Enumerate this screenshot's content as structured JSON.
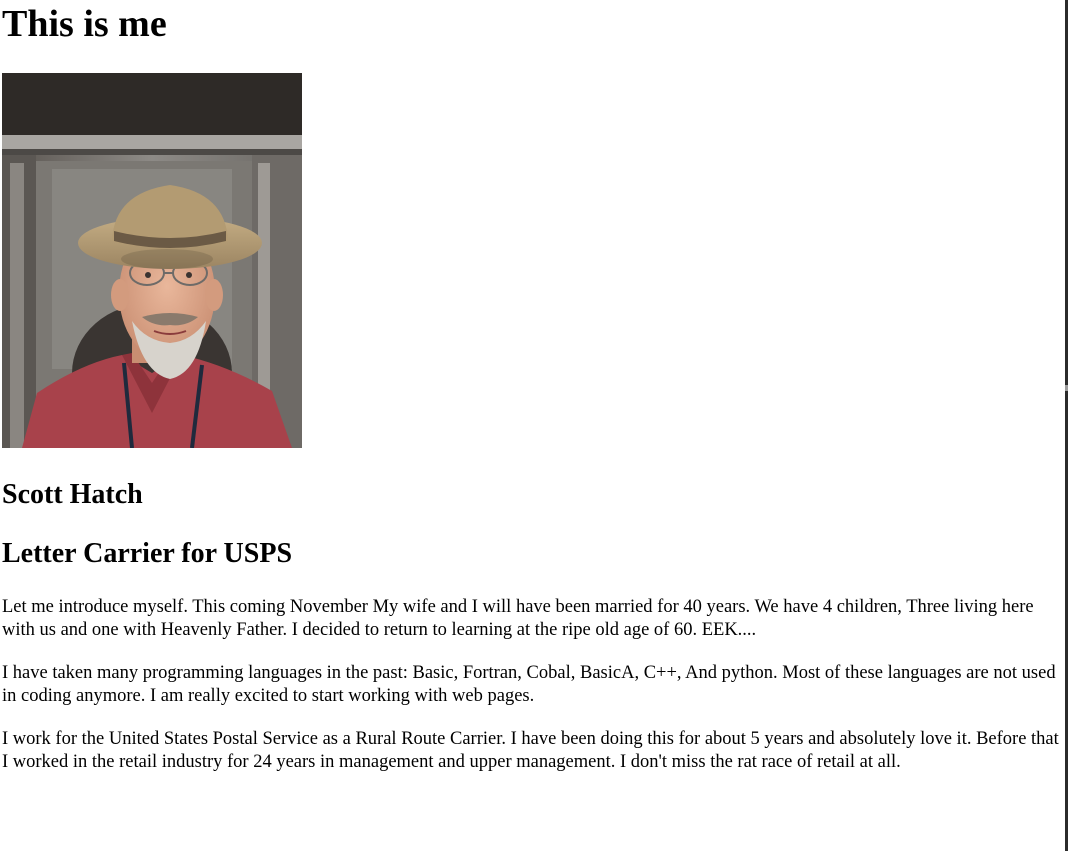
{
  "page": {
    "heading": "This is me",
    "photo_alt": "Photo of Scott Hatch",
    "name": "Scott Hatch",
    "job_title": "Letter Carrier for USPS",
    "paragraphs": [
      "Let me introduce myself. This coming November My wife and I will have been married for 40 years. We have 4 children, Three living here with us and one with Heavenly Father. I decided to return to learning at the ripe old age of 60. EEK....",
      "I have taken many programming languages in the past: Basic, Fortran, Cobal, BasicA, C++, And python. Most of these languages are not used in coding anymore. I am really excited to start working with web pages.",
      "I work for the United States Postal Service as a Rural Route Carrier. I have been doing this for about 5 years and absolutely love it. Before that I worked in the retail industry for 24 years in management and upper management. I don't miss the rat race of retail at all."
    ]
  }
}
